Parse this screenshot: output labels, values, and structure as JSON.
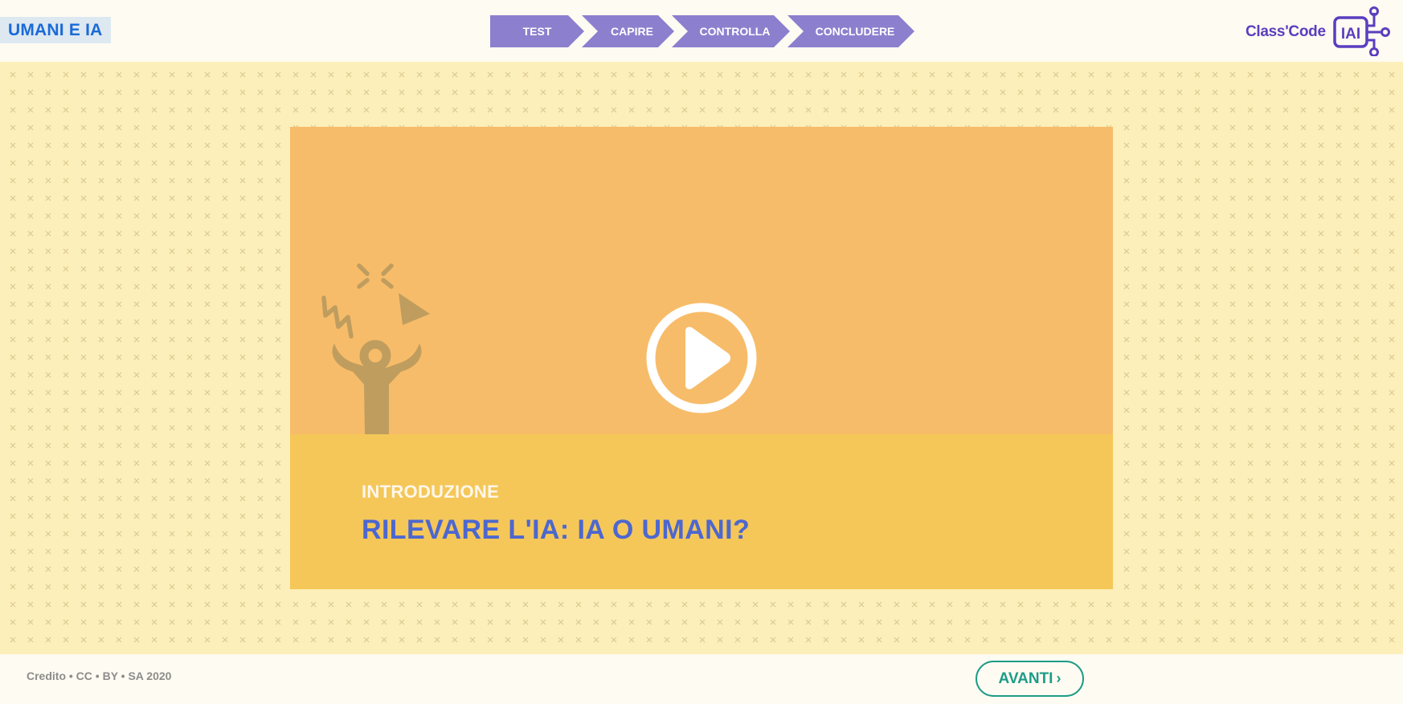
{
  "header": {
    "course_title": "UMANI E IA",
    "steps": [
      {
        "label": "TEST"
      },
      {
        "label": "CAPIRE"
      },
      {
        "label": "CONTROLLA"
      },
      {
        "label": "CONCLUDERE"
      }
    ],
    "logo": {
      "text": "Class'Code",
      "badge": "IAI"
    }
  },
  "video": {
    "kicker": "INTRODUZIONE",
    "title": "RILEVARE L'IA: IA O UMANI?",
    "play_icon": "play-circle-icon",
    "illustration": "confused-person-icon"
  },
  "footer": {
    "credit": "Credito • CC • BY • SA 2020",
    "next_label": "AVANTI",
    "next_icon": "chevron-right-icon"
  },
  "colors": {
    "course_title": "#1a6ad6",
    "steps": "#8c7fce",
    "logo": "#5a3ebf",
    "video_top": "#f7bc69",
    "video_bottom": "#f5c758",
    "title": "#4d67cf",
    "next_button": "#1c9c87"
  }
}
